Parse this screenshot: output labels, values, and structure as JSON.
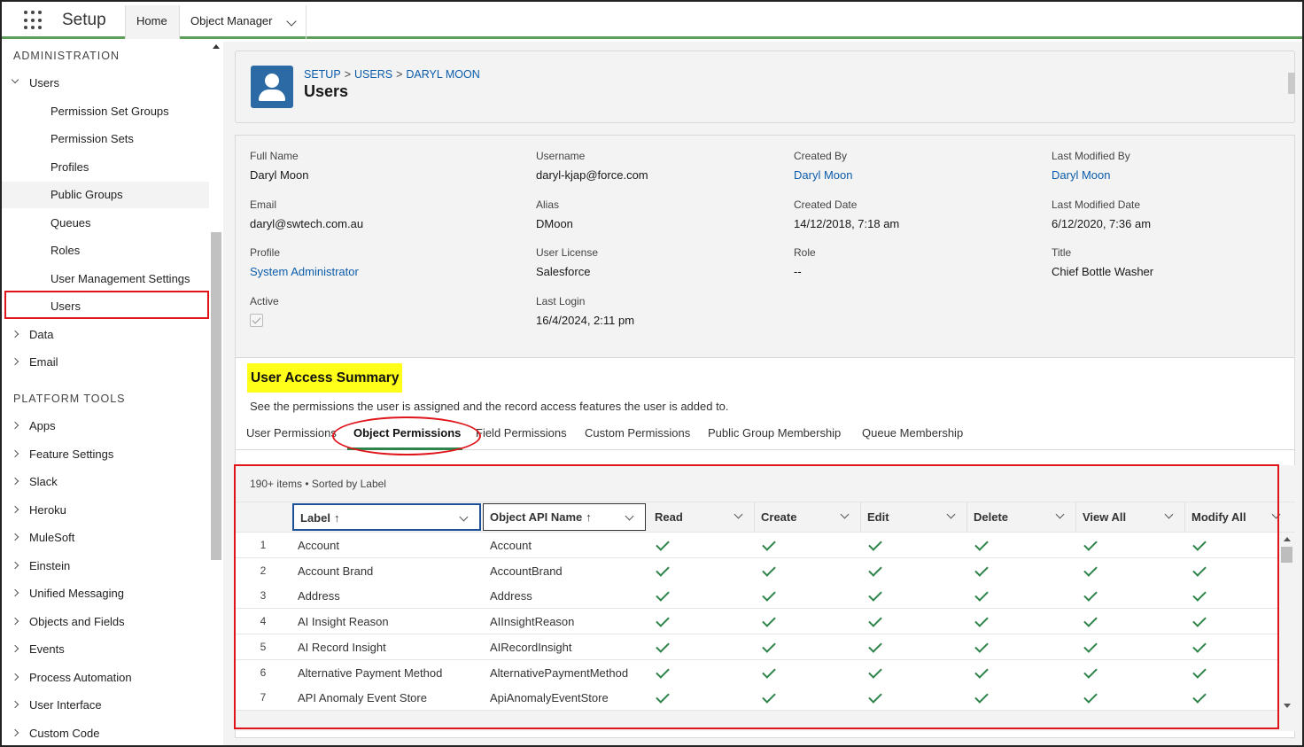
{
  "header": {
    "app_title": "Setup",
    "tabs": [
      {
        "label": "Home"
      },
      {
        "label": "Object Manager"
      }
    ]
  },
  "sidebar": {
    "administration_title": "ADMINISTRATION",
    "users_group": "Users",
    "user_items": [
      {
        "label": "Permission Set Groups"
      },
      {
        "label": "Permission Sets"
      },
      {
        "label": "Profiles"
      },
      {
        "label": "Public Groups"
      },
      {
        "label": "Queues"
      },
      {
        "label": "Roles"
      },
      {
        "label": "User Management Settings"
      },
      {
        "label": "Users"
      }
    ],
    "admin_groups": [
      {
        "label": "Data"
      },
      {
        "label": "Email"
      }
    ],
    "platform_title": "PLATFORM TOOLS",
    "platform_groups": [
      {
        "label": "Apps"
      },
      {
        "label": "Feature Settings"
      },
      {
        "label": "Slack"
      },
      {
        "label": "Heroku"
      },
      {
        "label": "MuleSoft"
      },
      {
        "label": "Einstein"
      },
      {
        "label": "Unified Messaging"
      },
      {
        "label": "Objects and Fields"
      },
      {
        "label": "Events"
      },
      {
        "label": "Process Automation"
      },
      {
        "label": "User Interface"
      },
      {
        "label": "Custom Code"
      }
    ]
  },
  "page_header": {
    "breadcrumb": [
      "SETUP",
      "USERS",
      "DARYL MOON"
    ],
    "separator": ">",
    "title": "Users"
  },
  "details": {
    "full_name": {
      "label": "Full Name",
      "value": "Daryl Moon"
    },
    "username": {
      "label": "Username",
      "value": "daryl-kjap@force.com"
    },
    "created_by": {
      "label": "Created By",
      "value": "Daryl Moon"
    },
    "last_modified_by": {
      "label": "Last Modified By",
      "value": "Daryl Moon"
    },
    "email": {
      "label": "Email",
      "value": "daryl@swtech.com.au"
    },
    "alias": {
      "label": "Alias",
      "value": "DMoon"
    },
    "created_date": {
      "label": "Created Date",
      "value": "14/12/2018, 7:18 am"
    },
    "last_modified_date": {
      "label": "Last Modified Date",
      "value": "6/12/2020, 7:36 am"
    },
    "profile": {
      "label": "Profile",
      "value": "System Administrator"
    },
    "user_license": {
      "label": "User License",
      "value": "Salesforce"
    },
    "role": {
      "label": "Role",
      "value": "--"
    },
    "title": {
      "label": "Title",
      "value": "Chief Bottle Washer"
    },
    "active": {
      "label": "Active",
      "checked": true
    },
    "last_login": {
      "label": "Last Login",
      "value": "16/4/2024, 2:11 pm"
    }
  },
  "access_summary": {
    "title": "User Access Summary",
    "description": "See the permissions the user is assigned and the record access features the user is added to.",
    "tabs": [
      {
        "label": "User Permissions"
      },
      {
        "label": "Object Permissions"
      },
      {
        "label": "Field Permissions"
      },
      {
        "label": "Custom Permissions"
      },
      {
        "label": "Public Group Membership"
      },
      {
        "label": "Queue Membership"
      }
    ],
    "active_tab": "Object Permissions"
  },
  "grid": {
    "info": "190+ items • Sorted by Label",
    "sort_arrow": "↑",
    "columns": [
      {
        "label": "Label"
      },
      {
        "label": "Object API Name"
      },
      {
        "label": "Read"
      },
      {
        "label": "Create"
      },
      {
        "label": "Edit"
      },
      {
        "label": "Delete"
      },
      {
        "label": "View All"
      },
      {
        "label": "Modify All"
      }
    ],
    "rows": [
      {
        "num": "1",
        "label": "Account",
        "api": "Account"
      },
      {
        "num": "2",
        "label": "Account Brand",
        "api": "AccountBrand"
      },
      {
        "num": "3",
        "label": "Address",
        "api": "Address"
      },
      {
        "num": "4",
        "label": "AI Insight Reason",
        "api": "AIInsightReason"
      },
      {
        "num": "5",
        "label": "AI Record Insight",
        "api": "AIRecordInsight"
      },
      {
        "num": "6",
        "label": "Alternative Payment Method",
        "api": "AlternativePaymentMethod"
      },
      {
        "num": "7",
        "label": "API Anomaly Event Store",
        "api": "ApiAnomalyEventStore"
      }
    ]
  },
  "colors": {
    "accent_green": "#2e844a",
    "link_blue": "#0b5cab",
    "highlight_yellow": "#ffff1a",
    "annotation_red": "#e0141b"
  }
}
